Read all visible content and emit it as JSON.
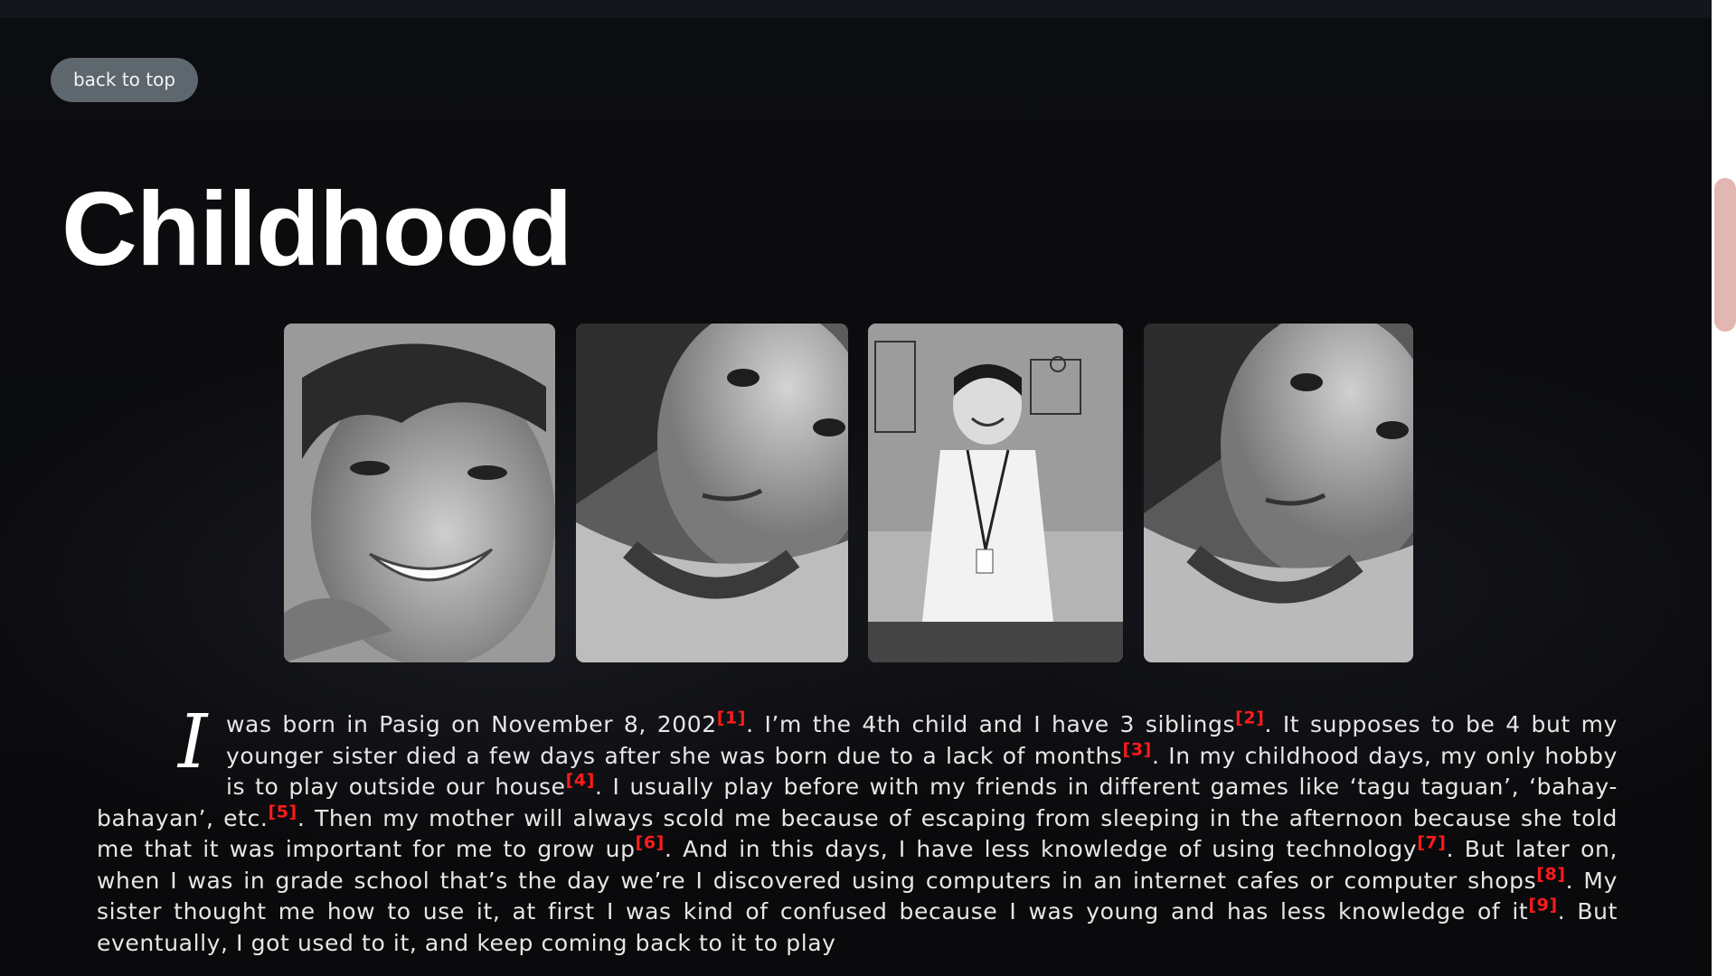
{
  "nav": {
    "back_to_top": "back to top"
  },
  "page": {
    "title": "Childhood"
  },
  "story": {
    "drop_cap": "I",
    "segments": [
      {
        "text": " was born in Pasig on November 8, 2002"
      },
      {
        "cite": "[1]"
      },
      {
        "text": ". I’m the 4th child and I have 3 siblings"
      },
      {
        "cite": "[2]"
      },
      {
        "text": ". It supposes to be 4 but my younger sister died a few days after she was born due to a lack of months"
      },
      {
        "cite": "[3]"
      },
      {
        "text": ". In my childhood days, my only hobby is to play outside our house"
      },
      {
        "cite": "[4]"
      },
      {
        "text": ". I usually play before with my friends in different games like ‘tagu taguan’, ‘bahay-bahayan’, etc."
      },
      {
        "cite": "[5]"
      },
      {
        "text": ". Then my mother will always scold me because of escaping from sleeping in the afternoon because she told me that it was important for me to grow up"
      },
      {
        "cite": "[6]"
      },
      {
        "text": ". And in this days, I have less knowledge of using technology"
      },
      {
        "cite": "[7]"
      },
      {
        "text": ". But later on, when I was in grade school that’s the day we’re I discovered using computers in an internet cafes or computer shops"
      },
      {
        "cite": "[8]"
      },
      {
        "text": ". My sister thought me how to use it, at first I was kind of confused because I was young and has less knowledge of it"
      },
      {
        "cite": "[9]"
      },
      {
        "text": ". But eventually, I got used to it, and keep coming back to it to play"
      }
    ]
  },
  "colors": {
    "citation": "#ff1b1b",
    "button_bg": "#5d676d",
    "scroll_thumb": "#e3b7b1"
  }
}
